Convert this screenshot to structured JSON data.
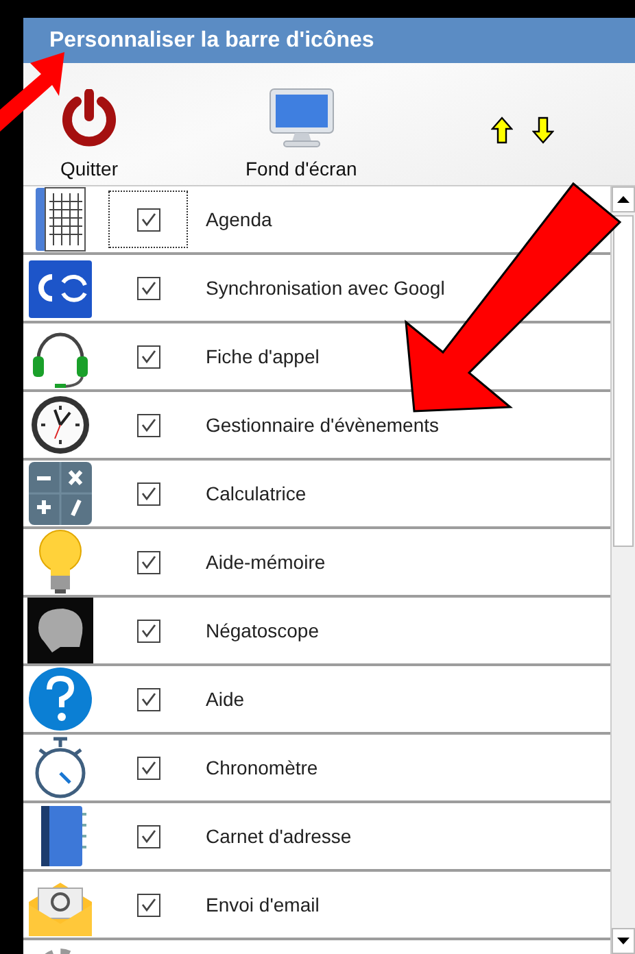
{
  "window": {
    "title": "Personnaliser la barre d'icônes"
  },
  "toolbar": {
    "buttons": [
      {
        "kind": "power",
        "label": "Quitter"
      },
      {
        "kind": "monitor",
        "label": "Fond d'écran"
      }
    ],
    "move_buttons": [
      {
        "kind": "up"
      },
      {
        "kind": "down"
      }
    ]
  },
  "items": [
    {
      "kind": "calendar",
      "label": "Agenda",
      "checked": true,
      "focused": true
    },
    {
      "kind": "sync",
      "label": "Synchronisation avec Googl",
      "checked": true,
      "focused": false
    },
    {
      "kind": "headset",
      "label": "Fiche d'appel",
      "checked": true,
      "focused": false
    },
    {
      "kind": "clock",
      "label": "Gestionnaire d'évènements",
      "checked": true,
      "focused": false
    },
    {
      "kind": "calculator",
      "label": "Calculatrice",
      "checked": true,
      "focused": false
    },
    {
      "kind": "bulb",
      "label": "Aide-mémoire",
      "checked": true,
      "focused": false
    },
    {
      "kind": "xray",
      "label": "Négatoscope",
      "checked": true,
      "focused": false
    },
    {
      "kind": "help",
      "label": "Aide",
      "checked": true,
      "focused": false
    },
    {
      "kind": "stopwatch",
      "label": "Chronomètre",
      "checked": true,
      "focused": false
    },
    {
      "kind": "addressbook",
      "label": "Carnet d'adresse",
      "checked": true,
      "focused": false
    },
    {
      "kind": "email",
      "label": "Envoi d'email",
      "checked": true,
      "focused": false
    },
    {
      "kind": "gear"
    }
  ]
}
